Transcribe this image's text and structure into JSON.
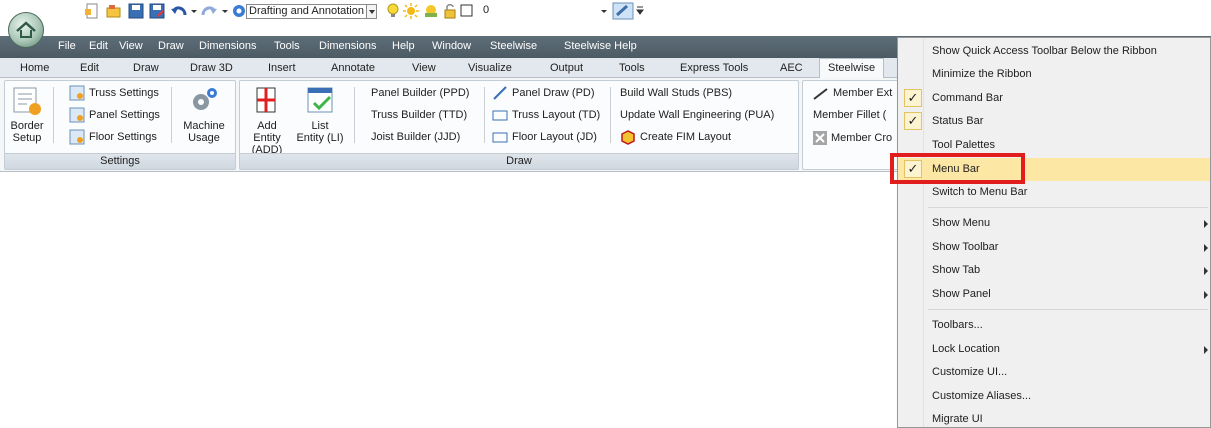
{
  "quick_access": {
    "workspace": "Drafting and Annotation",
    "layer_value": "0",
    "icons": [
      "new-icon",
      "open-icon",
      "save-icon",
      "saveas-icon",
      "undo-icon",
      "redo-icon",
      "gear-icon",
      "lightbulb-icon",
      "sun-icon",
      "layer-icon",
      "lock-icon",
      "square-icon",
      "color-icon",
      "dropdown-icon"
    ]
  },
  "menubar": {
    "items": [
      "File",
      "Edit",
      "View",
      "Draw",
      "Dimensions",
      "Tools",
      "Dimensions",
      "Help",
      "Window",
      "Steelwise",
      "Steelwise Help"
    ]
  },
  "tabs": {
    "items": [
      "Home",
      "Edit",
      "Draw",
      "Draw 3D",
      "Insert",
      "Annotate",
      "View",
      "Visualize",
      "Output",
      "Tools",
      "Express Tools",
      "AEC",
      "Steelwise"
    ],
    "active": "Steelwise"
  },
  "ribbon": {
    "settings_panel": {
      "title": "Settings",
      "border_setup": "Border\nSetup",
      "truss_settings": "Truss Settings",
      "panel_settings": "Panel Settings",
      "floor_settings": "Floor Settings",
      "machine_usage": "Machine\nUsage"
    },
    "draw_panel": {
      "title": "Draw",
      "add_entity": "Add Entity\n(ADD)",
      "list_entity": "List\nEntity (LI)",
      "panel_builder": "Panel Builder (PPD)",
      "truss_builder": "Truss Builder (TTD)",
      "joist_builder": "Joist Builder (JJD)",
      "panel_draw": "Panel Draw (PD)",
      "truss_layout": "Truss Layout (TD)",
      "floor_layout": "Floor Layout (JD)",
      "build_wall_studs": "Build Wall Studs (PBS)",
      "update_wall_engineering": "Update Wall Engineering (PUA)",
      "create_fim_layout": "Create FIM Layout"
    },
    "member_panel": {
      "member_ext": "Member Ext",
      "member_fillet": "Member Fillet (",
      "member_cro": "Member Cro"
    }
  },
  "context_menu": {
    "items": [
      {
        "label": "Show Quick Access Toolbar Below the Ribbon",
        "checked": false,
        "submenu": false
      },
      {
        "label": "Minimize the Ribbon",
        "checked": false,
        "submenu": false
      },
      {
        "label": "Command Bar",
        "checked": true,
        "submenu": false
      },
      {
        "label": "Status Bar",
        "checked": true,
        "submenu": false
      },
      {
        "label": "Tool Palettes",
        "checked": false,
        "submenu": false
      },
      {
        "label": "Menu Bar",
        "checked": true,
        "submenu": false,
        "highlighted": true
      },
      {
        "label": "Switch to Menu Bar",
        "checked": false,
        "submenu": false
      },
      {
        "label": "Show Menu",
        "checked": false,
        "submenu": true
      },
      {
        "label": "Show Toolbar",
        "checked": false,
        "submenu": true
      },
      {
        "label": "Show Tab",
        "checked": false,
        "submenu": true
      },
      {
        "label": "Show Panel",
        "checked": false,
        "submenu": true
      },
      {
        "label": "Toolbars...",
        "checked": false,
        "submenu": false
      },
      {
        "label": "Lock Location",
        "checked": false,
        "submenu": true
      },
      {
        "label": "Customize UI...",
        "checked": false,
        "submenu": false
      },
      {
        "label": "Customize Aliases...",
        "checked": false,
        "submenu": false
      },
      {
        "label": "Migrate UI",
        "checked": false,
        "submenu": false
      }
    ],
    "check_mark": "✓"
  },
  "colors": {
    "menubar": "#55646d",
    "highlight": "#fde7a5",
    "annotation_box": "#e21d1d"
  }
}
